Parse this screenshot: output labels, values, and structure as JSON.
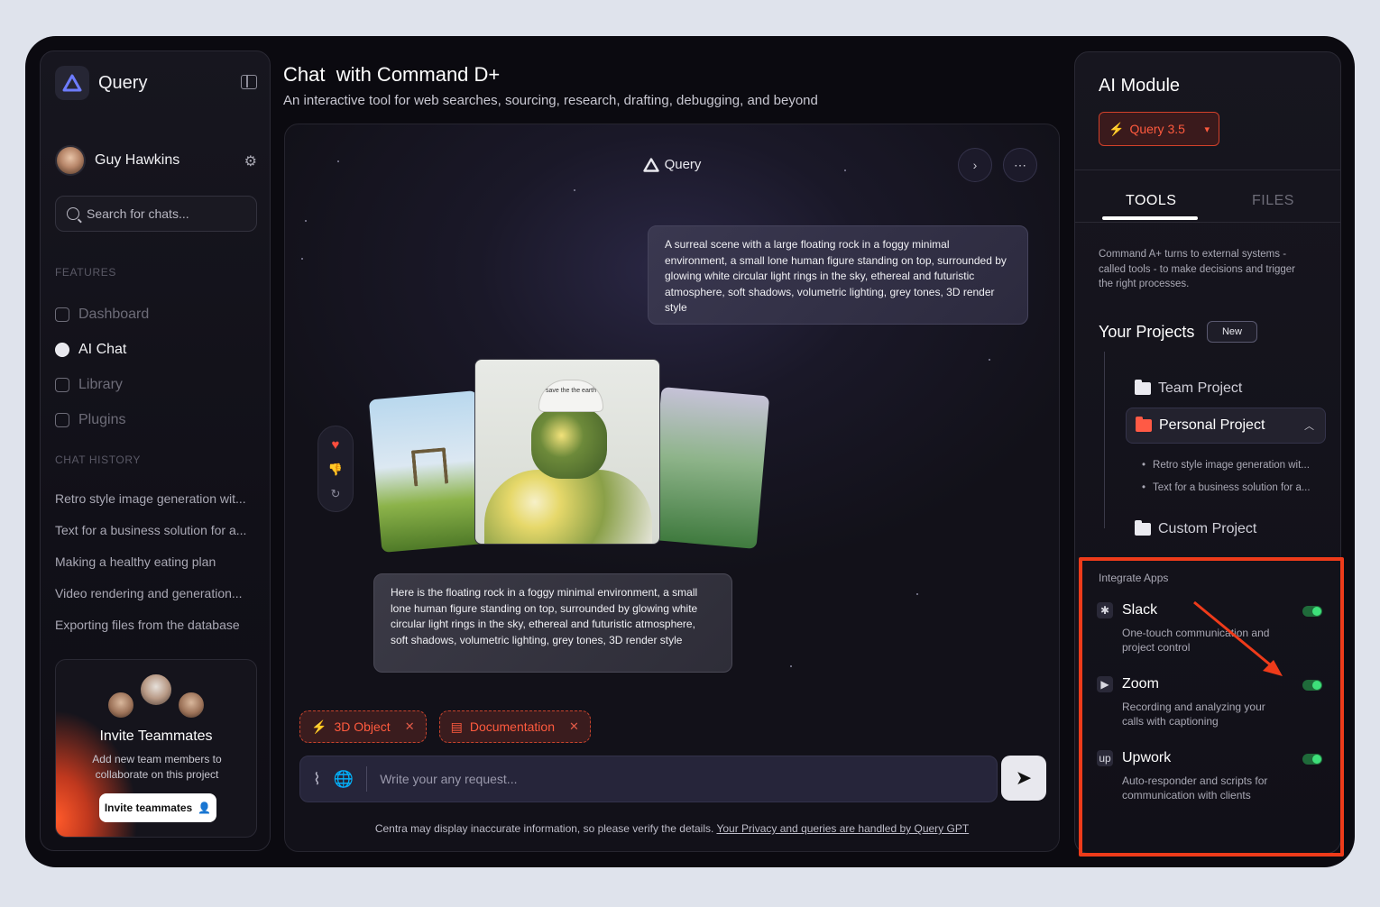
{
  "sidebar": {
    "brand": "Query",
    "user": "Guy Hawkins",
    "search_placeholder": "Search for chats...",
    "features_title": "FEATURES",
    "nav": [
      {
        "label": "Dashboard",
        "icon": "dashboard-icon"
      },
      {
        "label": "AI Chat",
        "icon": "chat-icon",
        "active": true
      },
      {
        "label": "Library",
        "icon": "library-icon"
      },
      {
        "label": "Plugins",
        "icon": "plugins-icon"
      }
    ],
    "history_title": "CHAT HISTORY",
    "history": [
      "Retro style image generation wit...",
      "Text for a business solution for a...",
      "Making a healthy eating plan",
      "Video rendering and generation...",
      "Exporting files from the database"
    ],
    "invite": {
      "title": "Invite Teammates",
      "desc": "Add new team members to collaborate on this project",
      "button": "Invite teammates"
    }
  },
  "main": {
    "title": "Chat  with Command D+",
    "subtitle": "An interactive tool for web searches, sourcing, research, drafting, debugging, and beyond",
    "chat_brand": "Query",
    "user_message": "A surreal scene with a large floating rock in a foggy minimal environment, a small lone human figure standing on top, surrounded by glowing white circular light rings in the sky, ethereal and futuristic atmosphere, soft shadows, volumetric lighting, grey tones, 3D render style",
    "ai_message": "Here is the floating rock in a foggy minimal environment, a small lone human figure standing on top, surrounded by glowing white circular light rings in the sky, ethereal and futuristic atmosphere, soft shadows, volumetric lighting, grey tones, 3D render style",
    "image_cap_text": "save the the earth",
    "tags": [
      "3D Object",
      "Documentation"
    ],
    "composer_placeholder": "Write your any request...",
    "footer_text": "Centra may display inaccurate information, so please verify the details.",
    "footer_link": "Your Privacy and queries are handled by Query GPT"
  },
  "right": {
    "title": "AI Module",
    "model": "Query 3.5",
    "tabs": [
      "TOOLS",
      "FILES"
    ],
    "desc": "Command A+ turns to external systems - called tools - to make decisions and trigger the right processes.",
    "projects_title": "Your Projects",
    "new_badge": "New",
    "projects": [
      "Team Project",
      "Personal Project",
      "Custom Project"
    ],
    "subitems": [
      "Retro style image generation wit...",
      "Text for a business solution for a..."
    ],
    "integrate_title": "Integrate Apps",
    "apps": [
      {
        "name": "Slack",
        "desc": "One-touch communication and project control",
        "icon": "slack-icon",
        "enabled": true
      },
      {
        "name": "Zoom",
        "desc": "Recording and analyzing your calls with captioning",
        "icon": "zoom-icon",
        "enabled": true
      },
      {
        "name": "Upwork",
        "desc": "Auto-responder and scripts for communication with clients",
        "icon": "upwork-icon",
        "enabled": true
      }
    ]
  },
  "colors": {
    "accent": "#ff5a3e",
    "highlight": "#ee3b1a",
    "toggle_on": "#3ee07a"
  }
}
